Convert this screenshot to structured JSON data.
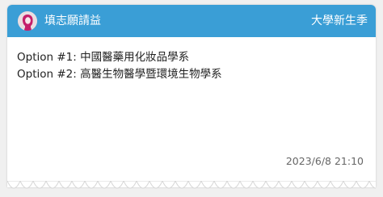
{
  "header": {
    "forum_title": "填志願請益",
    "school": "大學新生季",
    "avatar_icon": "pink-girl-avatar-icon",
    "color": "#3a9ed6"
  },
  "post": {
    "options": [
      "Option #1: 中國醫藥用化妝品學系",
      "Option #2: 高醫生物醫學暨環境生物學系"
    ],
    "timestamp": "2023/6/8 21:10"
  }
}
